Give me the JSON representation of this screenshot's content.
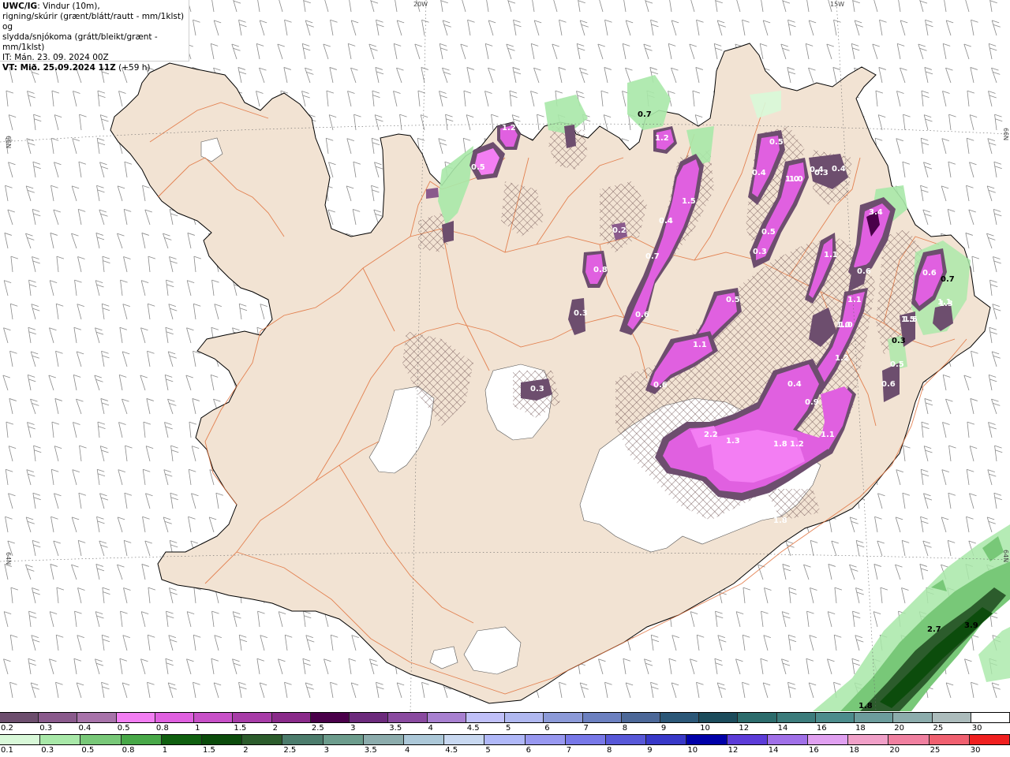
{
  "header": {
    "source": "UWC/IG",
    "desc_line1": ": Vindur (10m),",
    "desc_line2": "rigning/skúrir (grænt/blátt/rautt - mm/1klst) og",
    "desc_line3": "slydda/snjókoma (grátt/bleikt/grænt - mm/1klst)",
    "initial_time": "IT: Mán. 23. 09. 2024 00Z",
    "valid_time": "VT: Mið. 25.09.2024 11Z",
    "lead": "(+59 h)"
  },
  "graticule": {
    "lon_20w": "20W",
    "lon_15w": "15W",
    "lat_66n_left": "66N",
    "lat_66n_right": "66N",
    "lat_64n_left": "64N",
    "lat_64n_right": "64N"
  },
  "colors": {
    "land": "#f2e3d3",
    "coast": "#000000",
    "roads": "#e0703a",
    "glacier": "#ffffff",
    "wind_barb": "#8a8a8a",
    "snow_hatch": "#6b4e4e"
  },
  "snow_labels": [
    "0.7",
    "1.2",
    "1.2",
    "0.5",
    "1.0",
    "0.5",
    "0.4",
    "0.4",
    "0.3",
    "0.4",
    "1.0",
    "0.3",
    "0.4",
    "3.4",
    "1.1",
    "1.5",
    "0.4",
    "0.2",
    "0.7",
    "0.8",
    "0.5",
    "0.3",
    "0.6",
    "0.6",
    "1.5",
    "1.1",
    "1.0",
    "0.6",
    "1.1",
    "1.2",
    "1.0",
    "0.5",
    "0.3",
    "0.6",
    "1.8",
    "0.5",
    "1.3",
    "1.5",
    "0.7",
    "0.6",
    "0.4",
    "0.9",
    "2.2",
    "1.3",
    "1.8",
    "1.2",
    "1.1",
    "1.1",
    "0.3"
  ],
  "rain_labels": [
    "2.7",
    "3.9",
    "1.8"
  ],
  "snow_scale": {
    "label": "snjókoma",
    "values": [
      "0.2",
      "0.3",
      "0.4",
      "0.5",
      "0.8",
      "1",
      "1.5",
      "2",
      "2.5",
      "3",
      "3.5",
      "4",
      "4.5",
      "5",
      "6",
      "7",
      "8",
      "9",
      "10",
      "12",
      "14",
      "16",
      "18",
      "20",
      "25",
      "30"
    ],
    "colors": [
      "#6d4e6e",
      "#8a5a8c",
      "#a873aa",
      "#f37ef3",
      "#e060e0",
      "#c850c8",
      "#a83ca8",
      "#8a2a8a",
      "#4a004a",
      "#6c2a7c",
      "#8a4aa0",
      "#a880d0",
      "#c0c0f8",
      "#b0b8f0",
      "#8c9ad8",
      "#6c80c0",
      "#4c6898",
      "#2c5878",
      "#1c4c5c",
      "#2c6c6c",
      "#3c7c7c",
      "#4c8c8c",
      "#6c9c9c",
      "#8cacac",
      "#acbcbc",
      "#ffffff"
    ]
  },
  "rain_scale": {
    "label": "rigning",
    "values": [
      "0.1",
      "0.3",
      "0.5",
      "0.8",
      "1",
      "1.5",
      "2",
      "2.5",
      "3",
      "3.5",
      "4",
      "4.5",
      "5",
      "6",
      "7",
      "8",
      "9",
      "10",
      "12",
      "14",
      "16",
      "18",
      "20",
      "25",
      "30"
    ],
    "colors": [
      "#d8f8d8",
      "#a8e8a8",
      "#78c878",
      "#48a848",
      "#106010",
      "#0c4c0c",
      "#2c5c2c",
      "#4c7c6c",
      "#6c9c8c",
      "#8cacac",
      "#acc8d8",
      "#c8d8f0",
      "#b0b8f8",
      "#9898f0",
      "#7878e8",
      "#5858d8",
      "#3838c8",
      "#0000a8",
      "#5c3cd8",
      "#a070e8",
      "#e0a0f0",
      "#f0a0c8",
      "#f080a0",
      "#f06070",
      "#f02020"
    ]
  }
}
